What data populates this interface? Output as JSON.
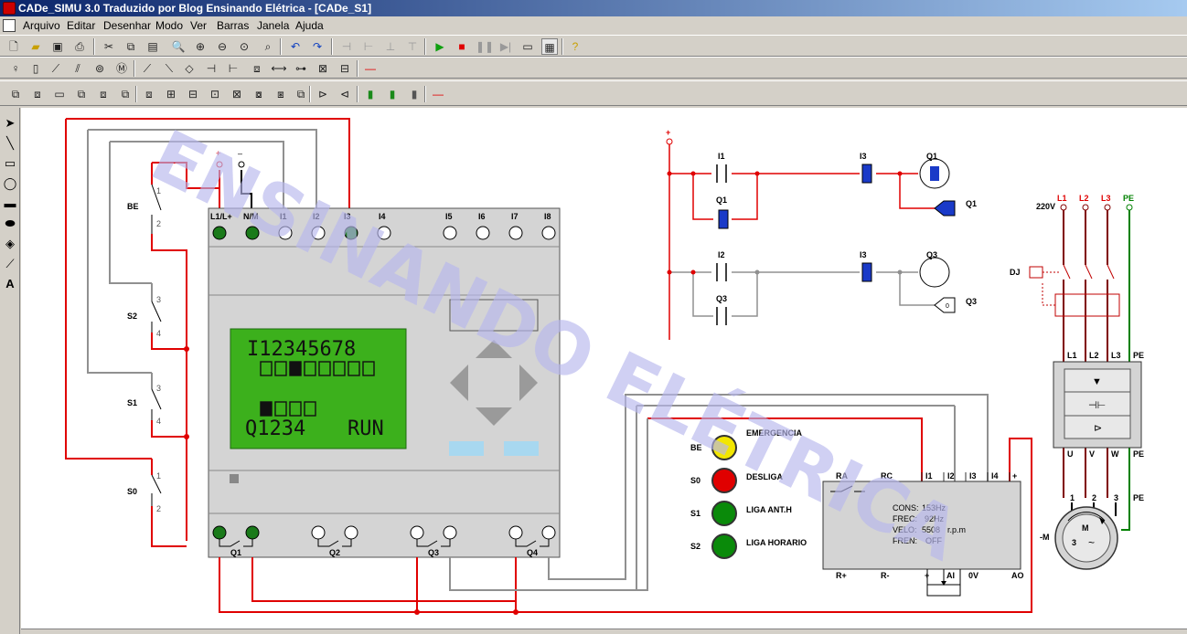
{
  "window": {
    "title": "CADe_SIMU 3.0 Traduzido por Blog Ensinando Elétrica - [CADe_S1]"
  },
  "menu": [
    "Arquivo",
    "Editar",
    "Desenhar",
    "Modo",
    "Ver",
    "Barras",
    "Janela",
    "Ajuda"
  ],
  "watermark": "ENSINANDO ELÉTRICA",
  "plc": {
    "supply_plus": "+",
    "supply_minus": "–",
    "input_labels": [
      "L1/L+",
      "N/M",
      "I1",
      "I2",
      "I3",
      "I4",
      "I5",
      "I6",
      "I7",
      "I8"
    ],
    "lcd_line1": "I12345678",
    "lcd_line4": "Q1234",
    "lcd_status": "RUN",
    "output_labels": [
      "Q1",
      "Q2",
      "Q3",
      "Q4"
    ]
  },
  "field_contacts": [
    {
      "name": "BE",
      "top": "1",
      "bottom": "2"
    },
    {
      "name": "S2",
      "top": "3",
      "bottom": "4"
    },
    {
      "name": "S1",
      "top": "3",
      "bottom": "4"
    },
    {
      "name": "S0",
      "top": "1",
      "bottom": "2"
    }
  ],
  "ladder": {
    "rail": "+",
    "rung1": {
      "contact1": "I1",
      "contact2": "I3",
      "coil": "Q1",
      "seal": "Q1",
      "output": "Q1"
    },
    "rung2": {
      "contact1": "I2",
      "contact2": "I3",
      "coil": "Q3",
      "seal": "Q3",
      "output": "Q3"
    }
  },
  "indicators": [
    {
      "code": "BE",
      "label": "EMERGENCIA",
      "color": "#f2e600"
    },
    {
      "code": "S0",
      "label": "DESLIGA",
      "color": "#e00000"
    },
    {
      "code": "S1",
      "label": "LIGA ANT.H",
      "color": "#0a8a0a"
    },
    {
      "code": "S2",
      "label": "LIGA HORARIO",
      "color": "#0a8a0a"
    }
  ],
  "vfd": {
    "top_terminals": [
      "RA",
      "RC",
      "I1",
      "I2",
      "I3",
      "I4",
      "+"
    ],
    "bottom_terminals": [
      "R+",
      "R-",
      "+",
      "AI",
      "0V",
      "AO"
    ],
    "cons_label": "CONS:",
    "cons_value": "153Hz",
    "frec_label": "FREC:",
    "frec_value": "92Hz",
    "velo_label": "VELO:",
    "velo_value": "5508",
    "velo_unit": "r.p.m",
    "fren_label": "FREN:",
    "fren_value": "OFF"
  },
  "power": {
    "voltage": "220V",
    "phases": [
      "L1",
      "L2",
      "L3",
      "PE"
    ],
    "breaker": "DJ",
    "drive_in": [
      "L1",
      "L2",
      "L3",
      "PE"
    ],
    "drive_out": [
      "U",
      "V",
      "W",
      "PE"
    ],
    "motor_terms": [
      "1",
      "2",
      "3",
      "PE"
    ],
    "motor_tag": "-M",
    "motor_letter": "M",
    "motor_phases": "3"
  },
  "colors": {
    "wire_red": "#e00000",
    "wire_gray": "#909090",
    "wire_green": "#008000",
    "lcd_bg": "#3cb01c",
    "key_blue": "#a8d8f0"
  }
}
